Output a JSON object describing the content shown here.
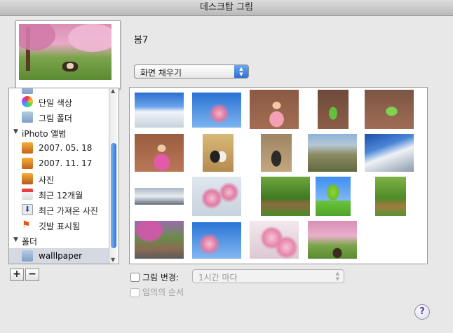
{
  "window": {
    "title": "데스크탑 그림"
  },
  "current_picture": {
    "name": "봄7"
  },
  "fit_select": {
    "value": "화면 채우기"
  },
  "sidebar": {
    "items": [
      {
        "label": "",
        "kind": "item",
        "icon": "folder-icon"
      },
      {
        "label": "단일 색상",
        "kind": "item",
        "icon": "color-wheel-icon"
      },
      {
        "label": "그림 폴더",
        "kind": "item",
        "icon": "folder-icon"
      },
      {
        "label": "iPhoto 앨범",
        "kind": "header"
      },
      {
        "label": "2007. 05. 18",
        "kind": "item",
        "icon": "event-icon"
      },
      {
        "label": "2007. 11. 17",
        "kind": "item",
        "icon": "event-icon"
      },
      {
        "label": "사진",
        "kind": "item",
        "icon": "photos-icon"
      },
      {
        "label": "최근 12개월",
        "kind": "item",
        "icon": "calendar-icon"
      },
      {
        "label": "최근 가져온 사진",
        "kind": "item",
        "icon": "import-icon"
      },
      {
        "label": "깃발 표시됨",
        "kind": "item",
        "icon": "flag-icon"
      },
      {
        "label": "폴더",
        "kind": "header"
      },
      {
        "label": "walllpaper",
        "kind": "item",
        "icon": "folder-icon",
        "selected": true
      }
    ],
    "add_label": "+",
    "remove_label": "−"
  },
  "change_picture": {
    "label": "그림 변경:",
    "interval": "1시간 마다"
  },
  "random_order": {
    "label": "임의의 순서"
  },
  "help": {
    "label": "?"
  },
  "colors": {
    "accent": "#3b7fe0",
    "selection": "#d4d9e2"
  }
}
